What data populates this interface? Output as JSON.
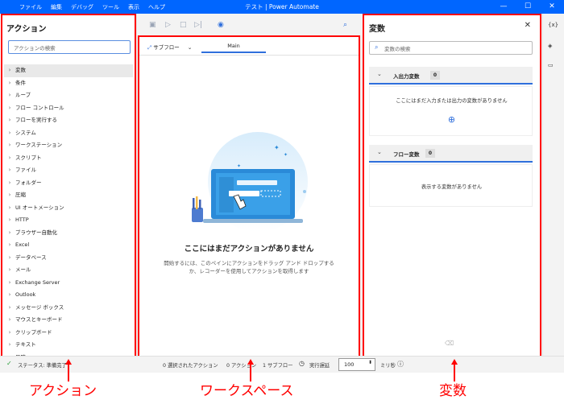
{
  "menu": [
    "ファイル",
    "編集",
    "デバッグ",
    "ツール",
    "表示",
    "ヘルプ"
  ],
  "window_title": "テスト | Power Automate",
  "window_controls": [
    "—",
    "☐",
    "✕"
  ],
  "actions": {
    "title": "アクション",
    "search_placeholder": "アクションの検索",
    "items": [
      "変数",
      "条件",
      "ループ",
      "フロー コントロール",
      "フローを実行する",
      "システム",
      "ワークステーション",
      "スクリプト",
      "ファイル",
      "フォルダー",
      "圧縮",
      "UI オートメーション",
      "HTTP",
      "ブラウザー自動化",
      "Excel",
      "データベース",
      "メール",
      "Exchange Server",
      "Outlook",
      "メッセージ ボックス",
      "マウスとキーボード",
      "クリップボード",
      "テキスト",
      "日時"
    ]
  },
  "workspace": {
    "subflow_label": "サブフロー",
    "main_tab": "Main",
    "empty_title": "ここにはまだアクションがありません",
    "empty_desc": "開始するには、このペインにアクションをドラッグ アンド ドロップするか、レコーダーを使用してアクションを取得します"
  },
  "variables": {
    "title": "変数",
    "search_placeholder": "変数の検索",
    "io_section": {
      "label": "入出力変数",
      "count": "0",
      "message": "ここにはまだ入力または出力の変数がありません"
    },
    "flow_section": {
      "label": "フロー変数",
      "count": "0",
      "message": "表示する変数がありません"
    }
  },
  "right_icons": [
    "{x}"
  ],
  "status": {
    "state": "ステータス: 準備完了",
    "selected": "0 選択されたアクション",
    "actions": "0 アクション",
    "subflows": "1 サブフロー",
    "delay_label": "実行遅延",
    "delay_value": "100",
    "unit": "ミリ秒"
  },
  "annotations": {
    "actions": "アクション",
    "workspace": "ワークスペース",
    "variables": "変数"
  },
  "colors": {
    "accent": "#0066ff",
    "highlight": "#ff0000"
  }
}
